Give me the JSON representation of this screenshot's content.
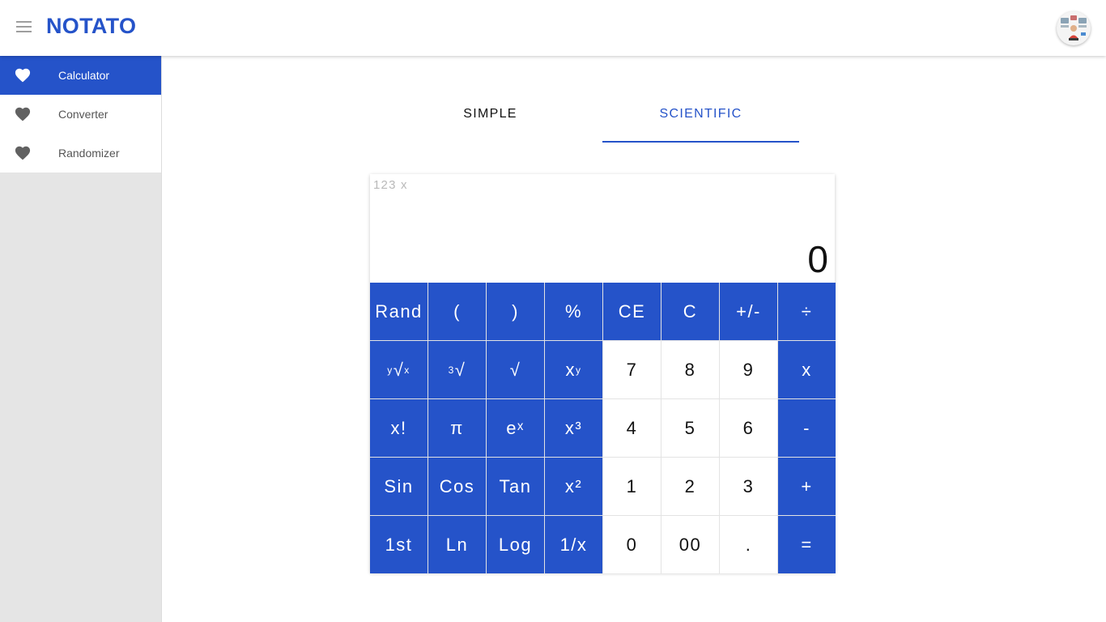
{
  "header": {
    "brand": "NOTATO",
    "menu_icon": "hamburger-menu-icon",
    "avatar_icon": "user-avatar-icon"
  },
  "sidebar": {
    "items": [
      {
        "label": "Calculator",
        "icon": "heart-icon",
        "active": true
      },
      {
        "label": "Converter",
        "icon": "heart-icon",
        "active": false
      },
      {
        "label": "Randomizer",
        "icon": "heart-icon",
        "active": false
      }
    ]
  },
  "tabs": [
    {
      "label": "SIMPLE",
      "active": false
    },
    {
      "label": "SCIENTIFIC",
      "active": true
    }
  ],
  "calculator": {
    "history": "123 x",
    "value": "0",
    "keys": [
      {
        "label": "Rand",
        "type": "op"
      },
      {
        "label": "(",
        "type": "op"
      },
      {
        "label": ")",
        "type": "op"
      },
      {
        "label": "%",
        "type": "op"
      },
      {
        "label": "CE",
        "type": "op"
      },
      {
        "label": "C",
        "type": "op"
      },
      {
        "label": "+/-",
        "type": "op"
      },
      {
        "label": "÷",
        "type": "op"
      },
      {
        "label": "y√x",
        "type": "op"
      },
      {
        "label": "3√",
        "type": "op"
      },
      {
        "label": "√",
        "type": "op"
      },
      {
        "label": "xy",
        "type": "op"
      },
      {
        "label": "7",
        "type": "num"
      },
      {
        "label": "8",
        "type": "num"
      },
      {
        "label": "9",
        "type": "num"
      },
      {
        "label": "x",
        "type": "op"
      },
      {
        "label": "x!",
        "type": "op"
      },
      {
        "label": "π",
        "type": "op"
      },
      {
        "label": "eˣ",
        "type": "op"
      },
      {
        "label": "x³",
        "type": "op"
      },
      {
        "label": "4",
        "type": "num"
      },
      {
        "label": "5",
        "type": "num"
      },
      {
        "label": "6",
        "type": "num"
      },
      {
        "label": "-",
        "type": "op"
      },
      {
        "label": "Sin",
        "type": "op"
      },
      {
        "label": "Cos",
        "type": "op"
      },
      {
        "label": "Tan",
        "type": "op"
      },
      {
        "label": "x²",
        "type": "op"
      },
      {
        "label": "1",
        "type": "num"
      },
      {
        "label": "2",
        "type": "num"
      },
      {
        "label": "3",
        "type": "num"
      },
      {
        "label": "+",
        "type": "op"
      },
      {
        "label": "1st",
        "type": "op"
      },
      {
        "label": "Ln",
        "type": "op"
      },
      {
        "label": "Log",
        "type": "op"
      },
      {
        "label": "1/x",
        "type": "op"
      },
      {
        "label": "0",
        "type": "num"
      },
      {
        "label": "00",
        "type": "num"
      },
      {
        "label": ".",
        "type": "num"
      },
      {
        "label": "=",
        "type": "op"
      }
    ]
  },
  "colors": {
    "accent": "#2553c9",
    "sidebar_bg": "#e5e5e5",
    "muted_text": "#b9b9b9"
  }
}
